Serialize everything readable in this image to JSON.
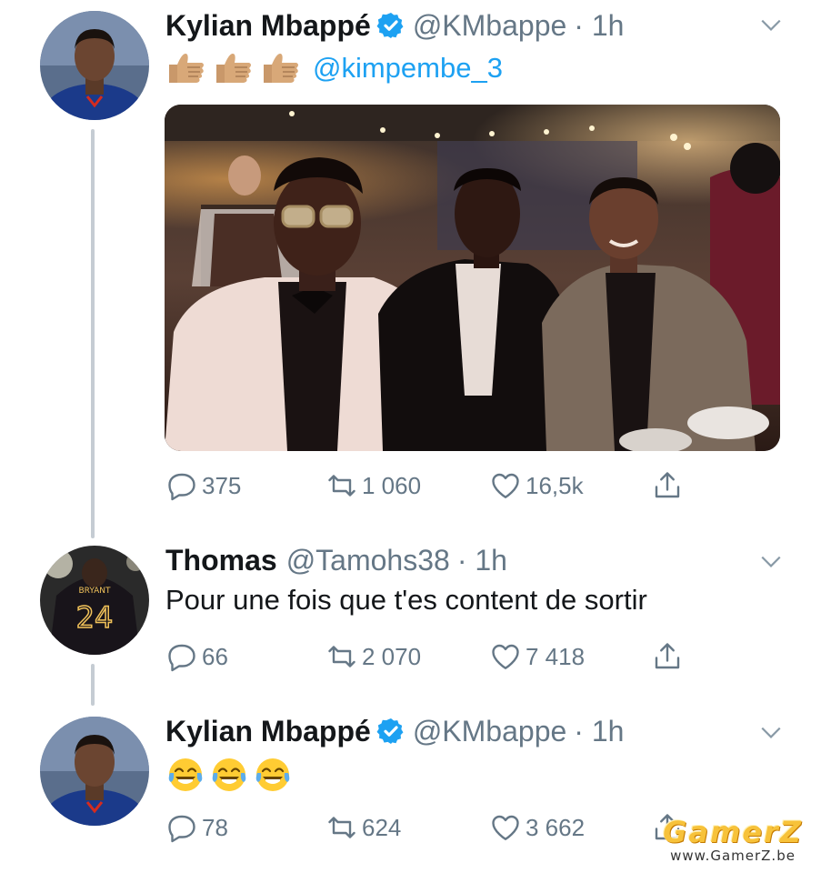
{
  "tweets": [
    {
      "name": "Kylian Mbappé",
      "verified": true,
      "handle": "@KMbappe",
      "time": "· 1h",
      "mention": "@kimpembe_3",
      "stats": {
        "replies": "375",
        "retweets": "1 060",
        "likes": "16,5k"
      }
    },
    {
      "name": "Thomas",
      "verified": false,
      "handle": "@Tamohs38",
      "time": "· 1h",
      "text": "Pour une fois que t'es content de sortir",
      "stats": {
        "replies": "66",
        "retweets": "2 070",
        "likes": "7 418"
      }
    },
    {
      "name": "Kylian Mbappé",
      "verified": true,
      "handle": "@KMbappe",
      "time": "· 1h",
      "stats": {
        "replies": "78",
        "retweets": "624",
        "likes": "3 662"
      }
    }
  ],
  "avatar_jersey_number": "24",
  "watermark": {
    "logo": "GamerZ",
    "url": "www.GamerZ.be"
  },
  "colors": {
    "link": "#1da1f2",
    "muted": "#657786",
    "verified": "#1da1f2",
    "thread_line": "#c5ccd3"
  }
}
